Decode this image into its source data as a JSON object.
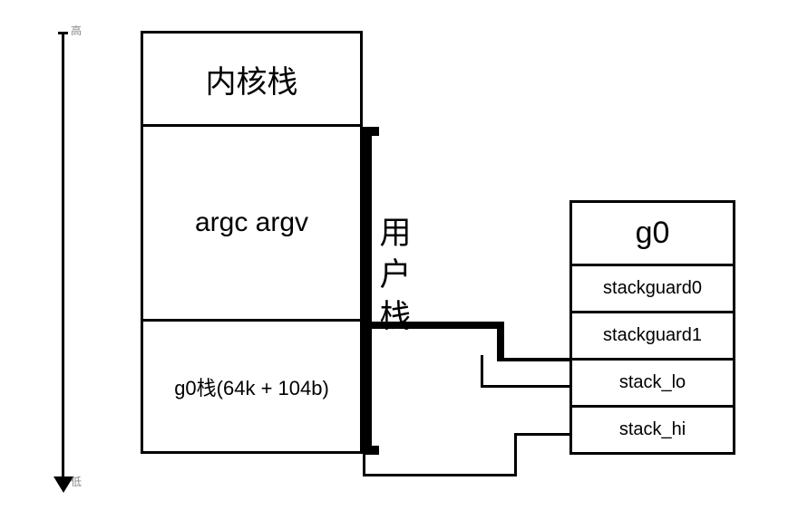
{
  "arrow": {
    "top_label": "高",
    "bottom_label": "低"
  },
  "stack": {
    "kernel": "内核栈",
    "argcv": "argc argv",
    "g0": "g0栈(64k + 104b)"
  },
  "user_stack_label": {
    "c1": "用",
    "c2": "户",
    "c3": "栈"
  },
  "g0_struct": {
    "title": "g0",
    "fields": [
      "stackguard0",
      "stackguard1",
      "stack_lo",
      "stack_hi"
    ]
  }
}
